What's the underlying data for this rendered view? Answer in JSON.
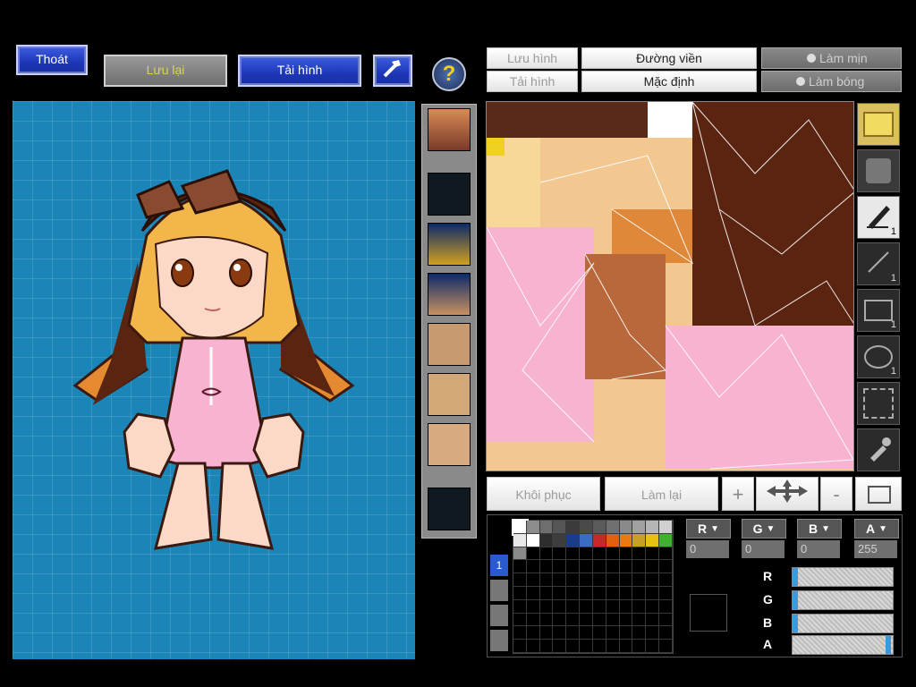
{
  "toolbar": {
    "exit_label": "Thoát",
    "save_label": "Lưu lại",
    "load_label": "Tải hình",
    "help_symbol": "?"
  },
  "options": {
    "save_image": "Lưu hình",
    "load_image": "Tải hình",
    "outline": "Đường viền",
    "default": "Mặc định",
    "smooth": "Làm mịn",
    "shade": "Làm bóng"
  },
  "actions": {
    "restore": "Khôi phục",
    "redo": "Làm lại",
    "zoom_in": "+",
    "zoom_out": "-"
  },
  "tools": {
    "pen_size": "1",
    "line_size": "1",
    "rect_size": "1",
    "ellipse_size": "1"
  },
  "color": {
    "channels": [
      "R",
      "G",
      "B",
      "A"
    ],
    "r_value": "0",
    "g_value": "0",
    "b_value": "0",
    "a_value": "255",
    "r_fraction": 0,
    "g_fraction": 0,
    "b_fraction": 0,
    "a_fraction": 1,
    "layer_number": "1",
    "palette": [
      "#ffffff",
      "#8c8c8c",
      "#6e6e6e",
      "#555555",
      "#3c3c3c",
      "#4a4a4a",
      "#5a5a5a",
      "#707070",
      "#8a8a8a",
      "#a0a0a0",
      "#b5b5b5",
      "#d0d0d0",
      "#e8e8e8",
      "#ffffff",
      "#2e2e2e",
      "#3d3d3d",
      "#1b3b8c",
      "#3a6cc4",
      "#c82828",
      "#e06010",
      "#e87a10",
      "#c8a028",
      "#e8c010",
      "#40b030",
      "#8a8a8a"
    ]
  }
}
